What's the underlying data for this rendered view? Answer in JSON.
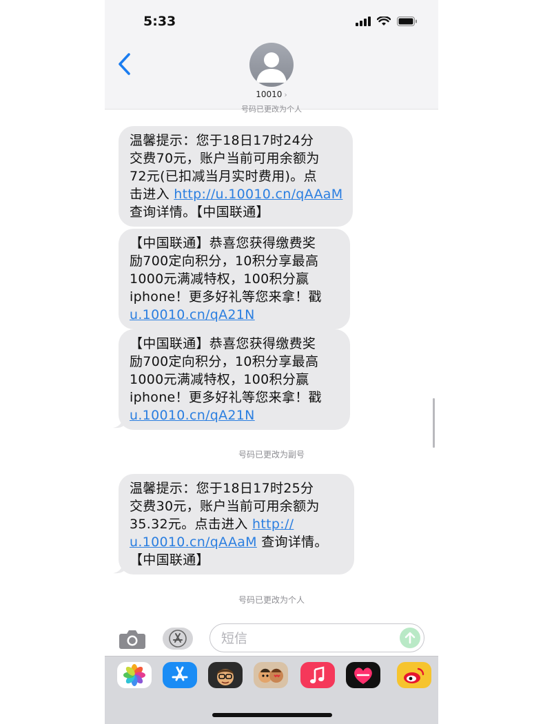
{
  "status_bar": {
    "time": "5:33"
  },
  "header": {
    "contact_name": "10010",
    "hidden_note": "号码已更改为个人"
  },
  "messages": [
    {
      "lines": [
        "温馨提示：您于18日17时24分",
        "交费70元，账户当前可用余额为",
        "72元(已扣减当月实时费用)。点"
      ],
      "link_prefix": "击进入 ",
      "link": "http://u.10010.cn/qAAaM",
      "after_link": "查询详情。【中国联通】"
    },
    {
      "lines": [
        "【中国联通】恭喜您获得缴费奖",
        "励700定向积分，10积分享最高",
        "1000元满减特权，100积分赢",
        "iphone！更多好礼等您来拿！戳"
      ],
      "link": "u.10010.cn/qA21N"
    },
    {
      "lines": [
        "【中国联通】恭喜您获得缴费奖",
        "励700定向积分，10积分享最高",
        "1000元满减特权，100积分赢",
        "iphone！更多好礼等您来拿！戳"
      ],
      "link": "u.10010.cn/qA21N"
    },
    {
      "lines": [
        "温馨提示：您于18日17时25分",
        "交费30元，账户当前可用余额为"
      ],
      "line3_prefix": "35.32元。点击进入 ",
      "link_part1": "http://",
      "link_part2": "u.10010.cn/qAAaM",
      "after_link": " 查询详情。",
      "last_line": "【中国联通】"
    }
  ],
  "system_notes": {
    "note_secondary": "号码已更改为副号",
    "note_personal": "号码已更改为个人"
  },
  "composer": {
    "placeholder": "短信"
  },
  "app_drawer": {
    "apps": [
      {
        "icon": "photos-icon",
        "color": "#ffffff"
      },
      {
        "icon": "app-store-icon",
        "color": "#1a8cf5"
      },
      {
        "icon": "memoji-icon",
        "color": "#2b2b2b"
      },
      {
        "icon": "memoji-stickers-icon",
        "color": "#d9c2a6"
      },
      {
        "icon": "music-icon",
        "color": "#f5385a"
      },
      {
        "icon": "digital-touch-icon",
        "color": "#111111"
      },
      {
        "icon": "weibo-icon",
        "color": "#f6c42e"
      }
    ]
  },
  "colors": {
    "bubble": "#e9e9eb",
    "link": "#2a7ee0",
    "accent": "#1a7cf0"
  }
}
